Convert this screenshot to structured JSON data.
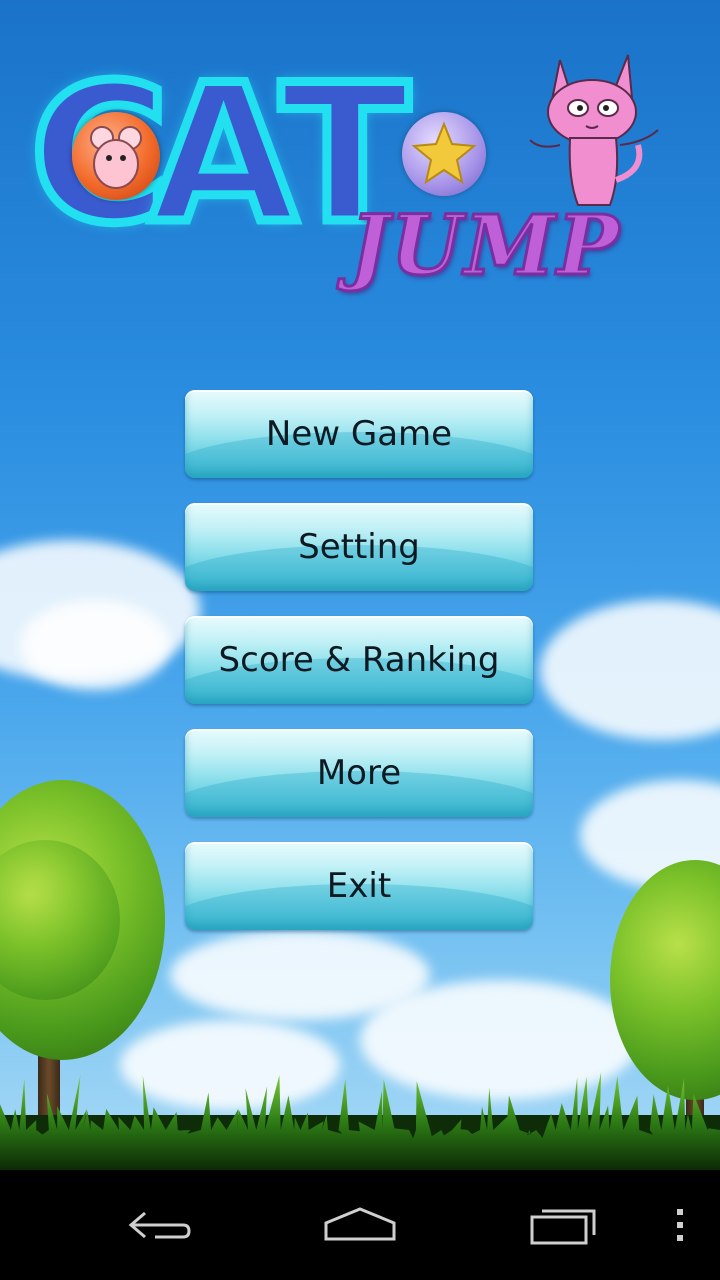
{
  "logo": {
    "word_cat": [
      "C",
      "A",
      "T"
    ],
    "word_jump": "JUMP"
  },
  "menu": {
    "items": [
      {
        "label": "New Game"
      },
      {
        "label": "Setting"
      },
      {
        "label": "Score & Ranking"
      },
      {
        "label": "More"
      },
      {
        "label": "Exit"
      }
    ]
  },
  "navbar": {
    "icons": [
      "back-icon",
      "home-icon",
      "recent-apps-icon",
      "overflow-menu-icon"
    ]
  },
  "colors": {
    "sky_top": "#1a73c9",
    "button_light": "#bff0f6",
    "button_dark": "#3ab5cc",
    "logo_stroke": "#22e0f0",
    "logo_fill": "#3a5bd0",
    "jump_color": "#c060d8"
  }
}
